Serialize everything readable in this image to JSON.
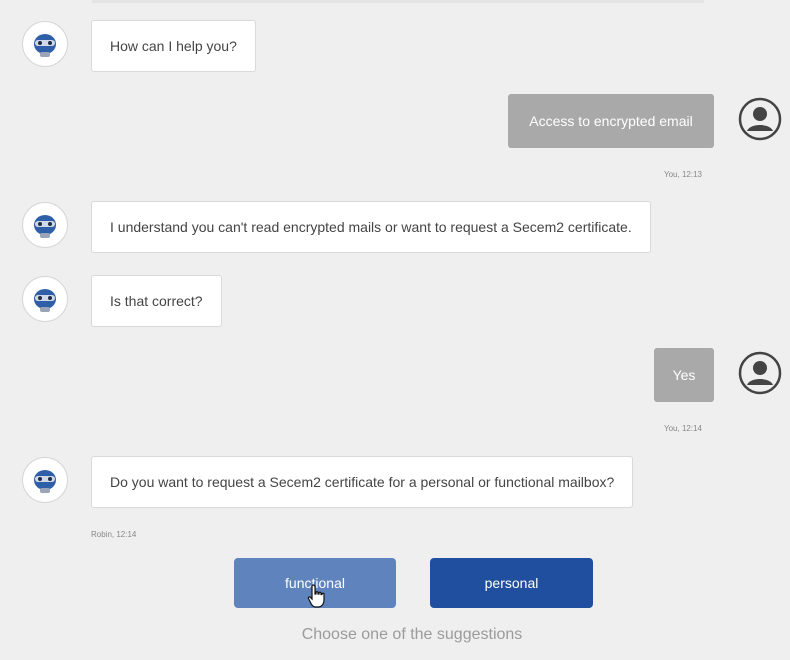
{
  "messages": [
    {
      "from": "bot",
      "text": "How can I help you?"
    },
    {
      "from": "user",
      "text": "Access to encrypted email",
      "meta": "You, 12:13"
    },
    {
      "from": "bot",
      "text": "I understand you can't read encrypted mails or want to request a Secem2 certificate."
    },
    {
      "from": "bot",
      "text": "Is that correct?"
    },
    {
      "from": "user",
      "text": "Yes",
      "meta": "You, 12:14"
    },
    {
      "from": "bot",
      "text": "Do you want to request a Secem2 certificate for a personal or functional mailbox?",
      "meta": "Robin, 12:14"
    }
  ],
  "suggestions": [
    {
      "label": "functional",
      "color": "#5f83bd"
    },
    {
      "label": "personal",
      "color": "#1f4f9e"
    }
  ],
  "hint": "Choose one of the suggestions",
  "colors": {
    "user_bubble": "#a9a9a9",
    "bot_bubble": "#ffffff",
    "background": "#efefef"
  },
  "icons": {
    "bot": "robot-icon",
    "user": "user-icon",
    "cursor": "hand-pointer-icon"
  }
}
